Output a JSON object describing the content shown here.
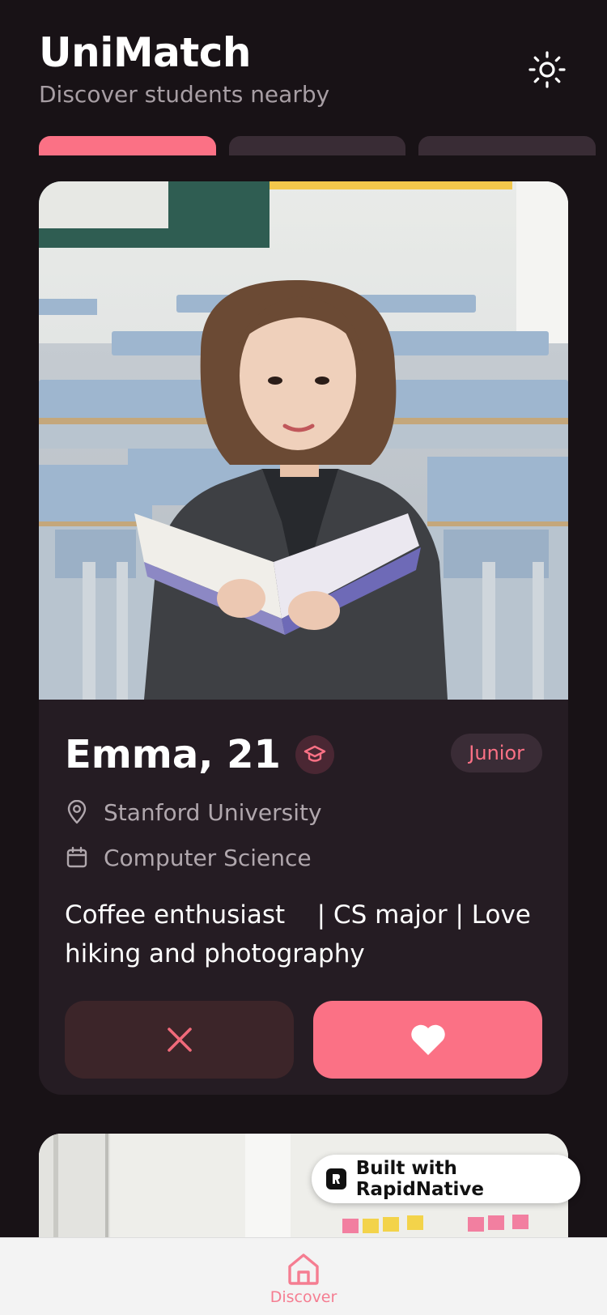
{
  "app": {
    "title": "UniMatch",
    "subtitle": "Discover students nearby"
  },
  "theme_toggle_icon": "sun-icon",
  "progress": {
    "total": 3,
    "active_index": 0
  },
  "profile": {
    "name_age": "Emma, 21",
    "year": "Junior",
    "university": "Stanford University",
    "major": "Computer Science",
    "bio": "Coffee enthusiast    | CS major | Love hiking and photography"
  },
  "actions": {
    "pass_icon": "close-icon",
    "like_icon": "heart-icon"
  },
  "badge": {
    "label": "Built with RapidNative"
  },
  "nav": {
    "discover_label": "Discover"
  },
  "colors": {
    "background": "#181216",
    "card": "#251c23",
    "accent": "#fb7185",
    "pass_button": "#3c2529",
    "muted_text": "#b0a7ad"
  }
}
